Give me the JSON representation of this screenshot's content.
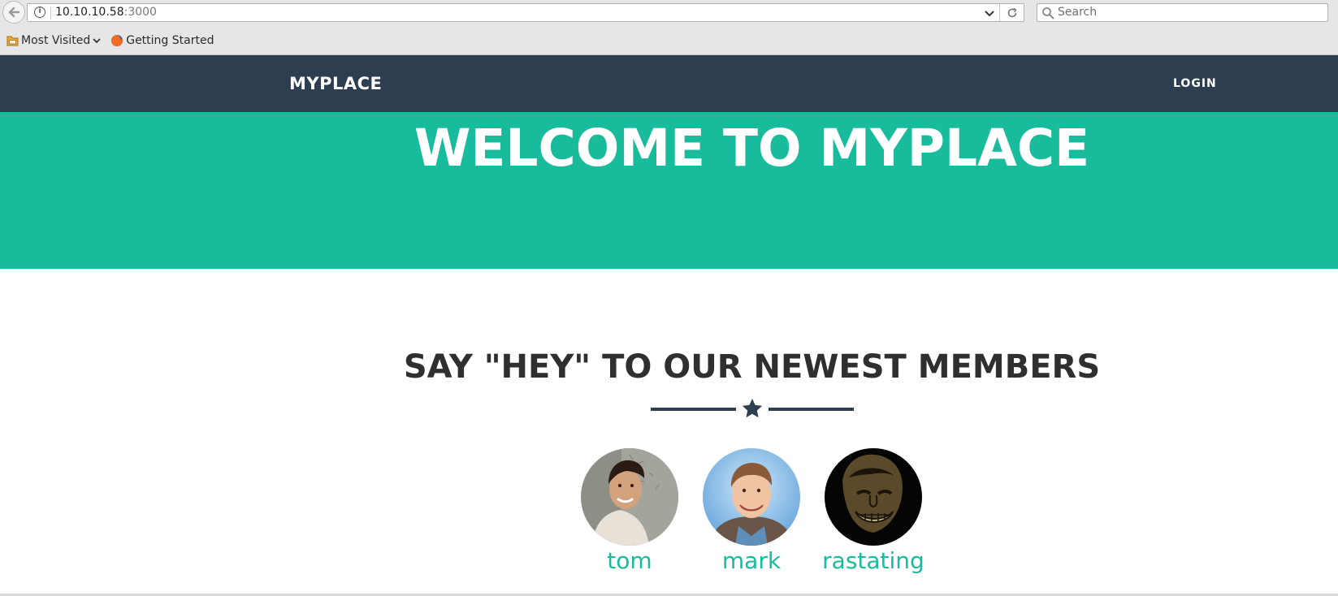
{
  "browser": {
    "url_host": "10.10.10.58",
    "url_port": ":3000",
    "search_placeholder": "Search",
    "bookmarks": [
      {
        "label": "Most Visited",
        "icon": "folder-icon"
      },
      {
        "label": "Getting Started",
        "icon": "firefox-icon"
      }
    ]
  },
  "site": {
    "brand": "MYPLACE",
    "login": "LOGIN",
    "hero_title": "WELCOME TO MYPLACE",
    "section_title": "SAY \"HEY\" TO OUR NEWEST MEMBERS",
    "members": [
      {
        "name": "tom"
      },
      {
        "name": "mark"
      },
      {
        "name": "rastating"
      }
    ]
  },
  "colors": {
    "navbar": "#2c3e50",
    "accent": "#18bc9c",
    "heading": "#2f2f2f"
  }
}
